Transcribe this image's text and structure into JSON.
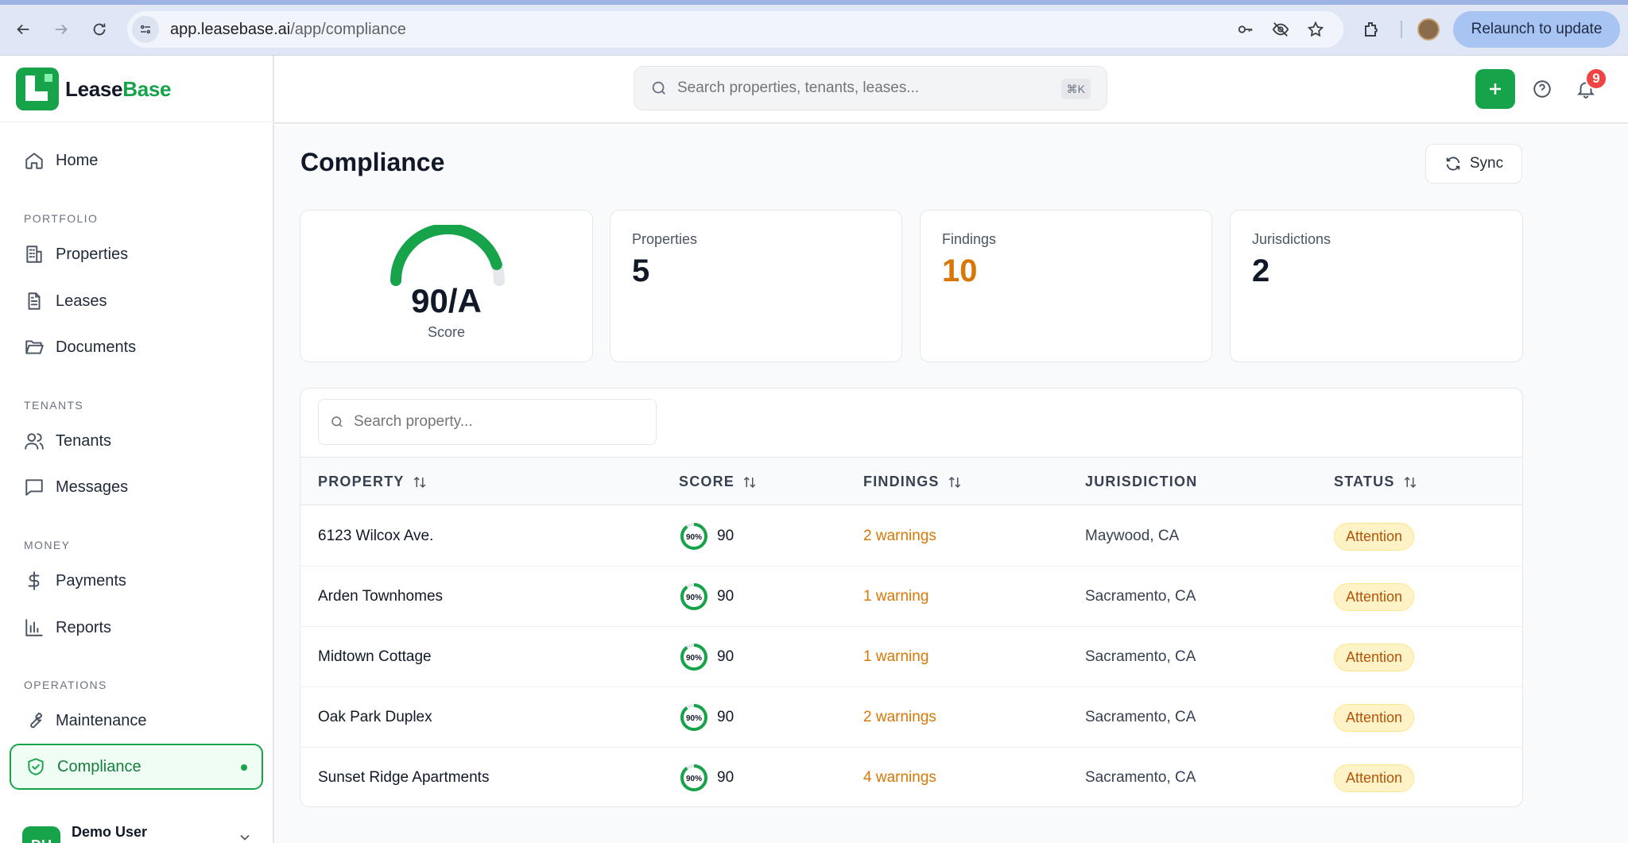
{
  "browser": {
    "url_host": "app.leasebase.ai",
    "url_path": "/app/compliance",
    "relaunch_label": "Relaunch to update"
  },
  "brand": {
    "name_a": "Lease",
    "name_b": "Base"
  },
  "sidebar": {
    "home": "Home",
    "sections": {
      "portfolio": "PORTFOLIO",
      "tenants": "TENANTS",
      "money": "MONEY",
      "operations": "OPERATIONS"
    },
    "items": {
      "properties": "Properties",
      "leases": "Leases",
      "documents": "Documents",
      "tenants": "Tenants",
      "messages": "Messages",
      "payments": "Payments",
      "reports": "Reports",
      "maintenance": "Maintenance",
      "compliance": "Compliance"
    },
    "user": {
      "initials": "DU",
      "name": "Demo User"
    }
  },
  "topbar": {
    "search_placeholder": "Search properties, tenants, leases...",
    "shortcut": "⌘K",
    "notifications_count": "9"
  },
  "page": {
    "title": "Compliance",
    "sync_label": "Sync"
  },
  "summary": {
    "score_value": "90/A",
    "score_label": "Score",
    "score_fraction": 0.9,
    "properties_label": "Properties",
    "properties_value": "5",
    "findings_label": "Findings",
    "findings_value": "10",
    "jurisdictions_label": "Jurisdictions",
    "jurisdictions_value": "2"
  },
  "table": {
    "search_placeholder": "Search property...",
    "headers": {
      "property": "PROPERTY",
      "score": "SCORE",
      "findings": "FINDINGS",
      "jurisdiction": "JURISDICTION",
      "status": "STATUS"
    },
    "rows": [
      {
        "property": "6123 Wilcox Ave.",
        "ring": "90%",
        "score": "90",
        "findings": "2 warnings",
        "jurisdiction": "Maywood, CA",
        "status": "Attention"
      },
      {
        "property": "Arden Townhomes",
        "ring": "90%",
        "score": "90",
        "findings": "1 warning",
        "jurisdiction": "Sacramento, CA",
        "status": "Attention"
      },
      {
        "property": "Midtown Cottage",
        "ring": "90%",
        "score": "90",
        "findings": "1 warning",
        "jurisdiction": "Sacramento, CA",
        "status": "Attention"
      },
      {
        "property": "Oak Park Duplex",
        "ring": "90%",
        "score": "90",
        "findings": "2 warnings",
        "jurisdiction": "Sacramento, CA",
        "status": "Attention"
      },
      {
        "property": "Sunset Ridge Apartments",
        "ring": "90%",
        "score": "90",
        "findings": "4 warnings",
        "jurisdiction": "Sacramento, CA",
        "status": "Attention"
      }
    ]
  },
  "colors": {
    "accent": "#16a34a",
    "warning": "#d97706",
    "badge_bg": "#fef3c7"
  }
}
